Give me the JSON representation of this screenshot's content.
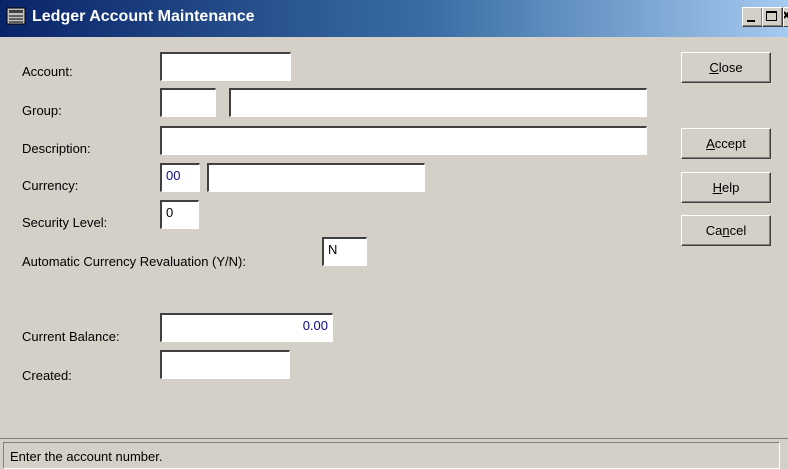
{
  "window": {
    "title": "Ledger Account Maintenance",
    "app_icon": "ledger-book-icon"
  },
  "form": {
    "account": {
      "label": "Account:",
      "value": ""
    },
    "group": {
      "label": "Group:",
      "code": "",
      "name": ""
    },
    "description": {
      "label": "Description:",
      "value": ""
    },
    "currency": {
      "label": "Currency:",
      "code": "00",
      "name": ""
    },
    "security_level": {
      "label": "Security Level:",
      "value": "0"
    },
    "auto_reval": {
      "label": "Automatic Currency Revaluation (Y/N):",
      "value": "N"
    },
    "current_balance": {
      "label": "Current Balance:",
      "value": "0.00"
    },
    "created": {
      "label": "Created:",
      "value": ""
    }
  },
  "buttons": {
    "close": {
      "pre": "",
      "key": "C",
      "post": "lose"
    },
    "accept": {
      "pre": "",
      "key": "A",
      "post": "ccept"
    },
    "help": {
      "pre": "",
      "key": "H",
      "post": "elp"
    },
    "cancel": {
      "pre": "Ca",
      "key": "n",
      "post": "cel"
    }
  },
  "status_bar": {
    "text": "Enter the account number."
  },
  "colors": {
    "title_bar": "#0a246a",
    "window_bg": "#d4d0c8",
    "value_text": "#0a0a8c"
  }
}
